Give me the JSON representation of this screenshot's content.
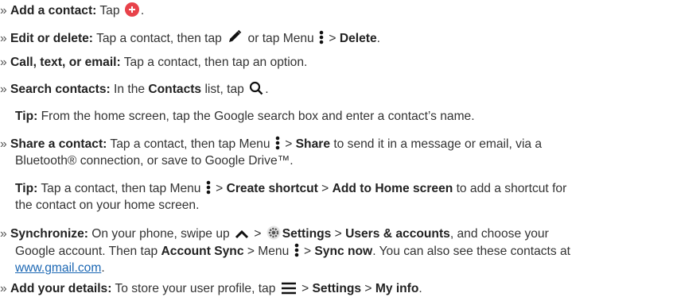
{
  "bullet": "»",
  "items": {
    "add_contact": {
      "label": "Add a contact:",
      "text_1": " Tap ",
      "text_2": ".",
      "icon": "add-contact-icon",
      "icon_color": "#e8424a"
    },
    "edit_delete": {
      "label": "Edit or delete:",
      "text_1": " Tap a contact, then tap ",
      "text_2": " or tap Menu ",
      "text_3": " > ",
      "bold_1": "Delete",
      "text_4": "."
    },
    "call": {
      "label": "Call, text, or email:",
      "text_1": " Tap a contact, then tap an option."
    },
    "search": {
      "label": "Search contacts:",
      "text_1": " In the ",
      "bold_1": "Contacts",
      "text_2": " list, tap ",
      "text_3": "."
    },
    "tip_search": {
      "label": "Tip:",
      "text_1": " From the home screen, tap the Google search box and enter a contact’s name."
    },
    "share": {
      "label": "Share a contact:",
      "text_1": " Tap a contact, then tap Menu ",
      "text_2": " > ",
      "bold_1": "Share",
      "text_3": " to send it in a message or email, via a",
      "line_2": "Bluetooth® connection, or save to Google Drive™."
    },
    "tip_shortcut": {
      "label": "Tip:",
      "text_1": " Tap a contact, then tap Menu ",
      "text_2": " > ",
      "bold_1": "Create shortcut",
      "text_3": " > ",
      "bold_2": "Add to Home screen",
      "text_4": " to add a shortcut for",
      "line_2": "the contact on your home screen."
    },
    "sync": {
      "label": "Synchronize:",
      "text_1": " On your phone, swipe up ",
      "text_2": " > ",
      "bold_1": "Settings",
      "text_3": " > ",
      "bold_2": "Users & accounts",
      "text_4": ", and choose your",
      "line_2a": "Google account. Then tap ",
      "bold_3": "Account Sync",
      "text_5": " > Menu ",
      "text_6": " > ",
      "bold_4": "Sync now",
      "text_7": ". You can also see these contacts at",
      "link": "www.gmail.com",
      "text_8": "."
    },
    "details": {
      "label": "Add your details:",
      "text_1": " To store your user profile, tap ",
      "text_2": " > ",
      "bold_1": "Settings",
      "text_3": " > ",
      "bold_2": "My info",
      "text_4": "."
    }
  }
}
